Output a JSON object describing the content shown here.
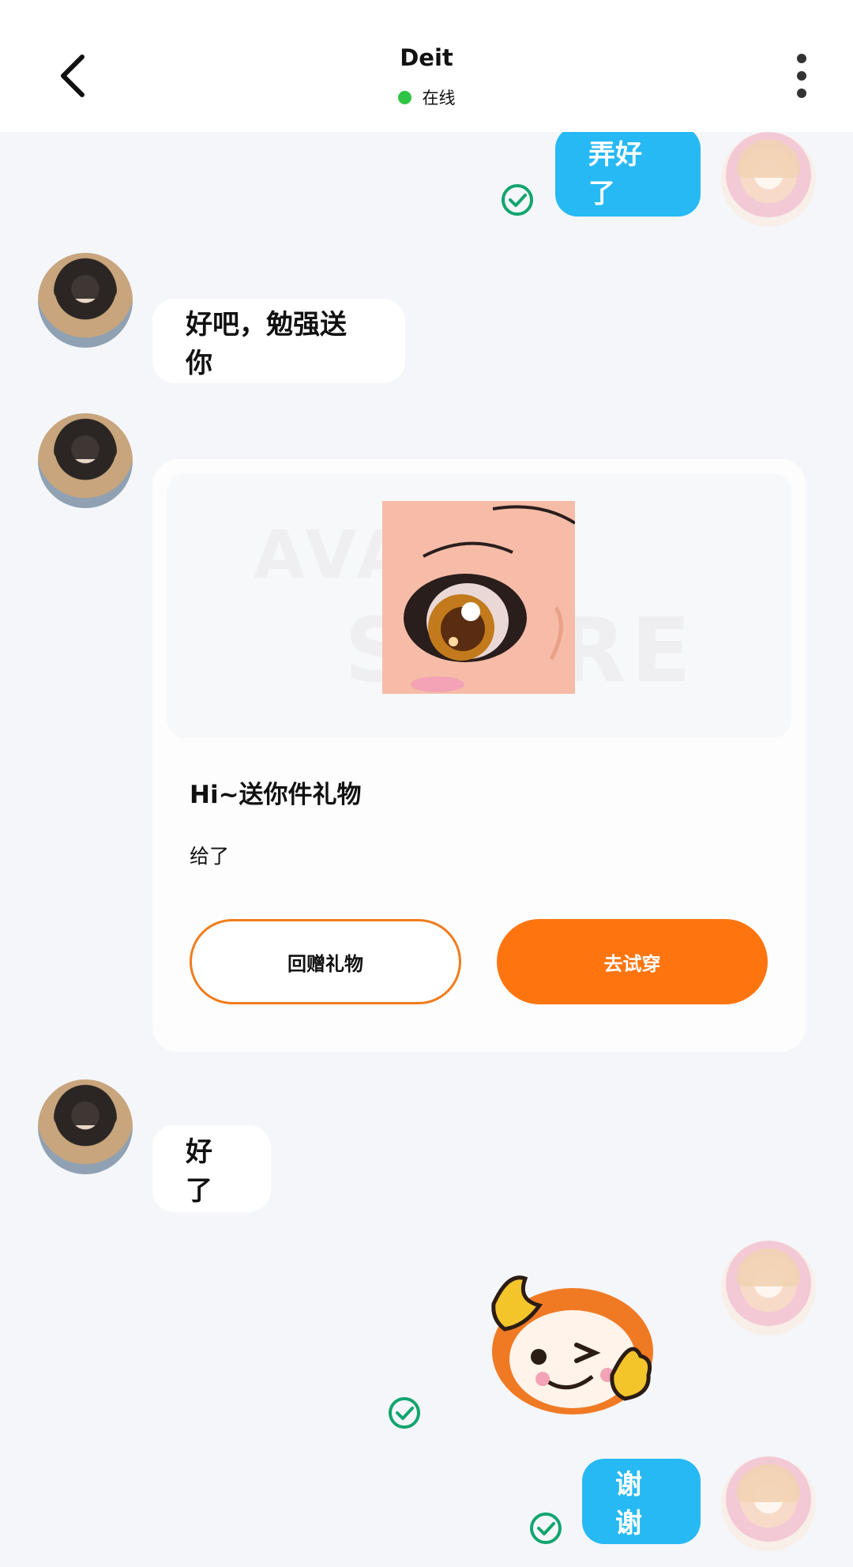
{
  "header": {
    "title": "Deit",
    "status": "在线",
    "status_color": "#2fc446"
  },
  "messages": {
    "m1": "弄好了",
    "m2": "好吧，勉强送你",
    "m3": "好了",
    "m4": "谢谢"
  },
  "gift_card": {
    "watermark_line1": "AVATAR",
    "watermark_line2": "STORE",
    "title": "Hi~送你件礼物",
    "description": "给了",
    "return_gift_label": "回赠礼物",
    "try_on_label": "去试穿",
    "accent": "#fe7510"
  },
  "colors": {
    "outgoing_bubble": "#27b9f4",
    "check": "#12a56f"
  },
  "icons": {
    "back": "chevron-left-icon",
    "more": "more-vertical-icon",
    "sent": "check-circle-icon"
  }
}
